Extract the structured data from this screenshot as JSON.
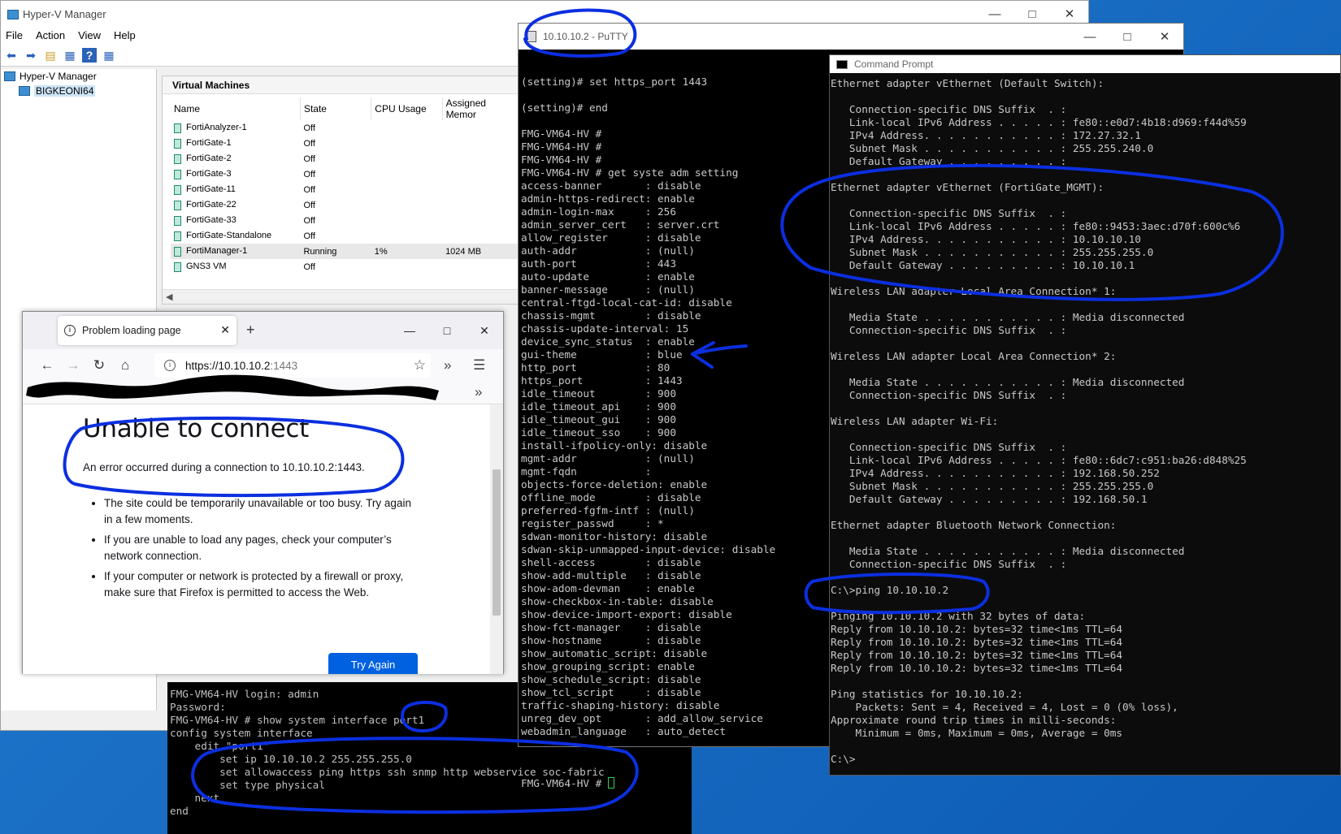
{
  "hyperv": {
    "title": "Hyper-V Manager",
    "menu": [
      "File",
      "Action",
      "View",
      "Help"
    ],
    "tree_root": "Hyper-V Manager",
    "tree_child": "BIGKEONI64",
    "panel_title": "Virtual Machines",
    "columns": [
      "Name",
      "State",
      "CPU Usage",
      "Assigned Memor"
    ],
    "vms": [
      {
        "name": "FortiAnalyzer-1",
        "state": "Off",
        "cpu": "",
        "mem": ""
      },
      {
        "name": "FortiGate-1",
        "state": "Off",
        "cpu": "",
        "mem": ""
      },
      {
        "name": "FortiGate-2",
        "state": "Off",
        "cpu": "",
        "mem": ""
      },
      {
        "name": "FortiGate-3",
        "state": "Off",
        "cpu": "",
        "mem": ""
      },
      {
        "name": "FortiGate-11",
        "state": "Off",
        "cpu": "",
        "mem": ""
      },
      {
        "name": "FortiGate-22",
        "state": "Off",
        "cpu": "",
        "mem": ""
      },
      {
        "name": "FortiGate-33",
        "state": "Off",
        "cpu": "",
        "mem": ""
      },
      {
        "name": "FortiGate-Standalone",
        "state": "Off",
        "cpu": "",
        "mem": ""
      },
      {
        "name": "FortiManager-1",
        "state": "Running",
        "cpu": "1%",
        "mem": "1024 MB"
      },
      {
        "name": "GNS3 VM",
        "state": "Off",
        "cpu": "",
        "mem": ""
      }
    ]
  },
  "putty": {
    "title": "10.10.10.2 - PuTTY",
    "lines": [
      "(setting)# set https_port 1443",
      "",
      "(setting)# end",
      "",
      "FMG-VM64-HV #",
      "FMG-VM64-HV #",
      "FMG-VM64-HV #",
      "FMG-VM64-HV # get syste adm setting",
      "access-banner       : disable",
      "admin-https-redirect: enable",
      "admin-login-max     : 256",
      "admin_server_cert   : server.crt",
      "allow_register      : disable",
      "auth-addr           : (null)",
      "auth-port           : 443",
      "auto-update         : enable",
      "banner-message      : (null)",
      "central-ftgd-local-cat-id: disable",
      "chassis-mgmt        : disable",
      "chassis-update-interval: 15",
      "device_sync_status  : enable",
      "gui-theme           : blue",
      "http_port           : 80",
      "https_port          : 1443",
      "idle_timeout        : 900",
      "idle_timeout_api    : 900",
      "idle_timeout_gui    : 900",
      "idle_timeout_sso    : 900",
      "install-ifpolicy-only: disable",
      "mgmt-addr           : (null)",
      "mgmt-fqdn           :",
      "objects-force-deletion: enable",
      "offline_mode        : disable",
      "preferred-fgfm-intf : (null)",
      "register_passwd     : *",
      "sdwan-monitor-history: disable",
      "sdwan-skip-unmapped-input-device: disable",
      "shell-access        : disable",
      "show-add-multiple   : disable",
      "show-adom-devman    : enable",
      "show-checkbox-in-table: disable",
      "show-device-import-export: disable",
      "show-fct-manager    : disable",
      "show-hostname       : disable",
      "show_automatic_script: disable",
      "show_grouping_script: enable",
      "show_schedule_script: disable",
      "show_tcl_script     : disable",
      "traffic-shaping-history: disable",
      "unreg_dev_opt       : add_allow_service",
      "webadmin_language   : auto_detect",
      ""
    ],
    "prompt": "FMG-VM64-HV # "
  },
  "cmd": {
    "title": "Command Prompt",
    "lines": [
      "Ethernet adapter vEthernet (Default Switch):",
      "",
      "   Connection-specific DNS Suffix  . :",
      "   Link-local IPv6 Address . . . . . : fe80::e0d7:4b18:d969:f44d%59",
      "   IPv4 Address. . . . . . . . . . . : 172.27.32.1",
      "   Subnet Mask . . . . . . . . . . . : 255.255.240.0",
      "   Default Gateway . . . . . . . . . :",
      "",
      "Ethernet adapter vEthernet (FortiGate_MGMT):",
      "",
      "   Connection-specific DNS Suffix  . :",
      "   Link-local IPv6 Address . . . . . : fe80::9453:3aec:d70f:600c%6",
      "   IPv4 Address. . . . . . . . . . . : 10.10.10.10",
      "   Subnet Mask . . . . . . . . . . . : 255.255.255.0",
      "   Default Gateway . . . . . . . . . : 10.10.10.1",
      "",
      "Wireless LAN adapter Local Area Connection* 1:",
      "",
      "   Media State . . . . . . . . . . . : Media disconnected",
      "   Connection-specific DNS Suffix  . :",
      "",
      "Wireless LAN adapter Local Area Connection* 2:",
      "",
      "   Media State . . . . . . . . . . . : Media disconnected",
      "   Connection-specific DNS Suffix  . :",
      "",
      "Wireless LAN adapter Wi-Fi:",
      "",
      "   Connection-specific DNS Suffix  . :",
      "   Link-local IPv6 Address . . . . . : fe80::6dc7:c951:ba26:d848%25",
      "   IPv4 Address. . . . . . . . . . . : 192.168.50.252",
      "   Subnet Mask . . . . . . . . . . . : 255.255.255.0",
      "   Default Gateway . . . . . . . . . : 192.168.50.1",
      "",
      "Ethernet adapter Bluetooth Network Connection:",
      "",
      "   Media State . . . . . . . . . . . : Media disconnected",
      "   Connection-specific DNS Suffix  . :",
      "",
      "C:\\>ping 10.10.10.2",
      "",
      "Pinging 10.10.10.2 with 32 bytes of data:",
      "Reply from 10.10.10.2: bytes=32 time<1ms TTL=64",
      "Reply from 10.10.10.2: bytes=32 time<1ms TTL=64",
      "Reply from 10.10.10.2: bytes=32 time<1ms TTL=64",
      "Reply from 10.10.10.2: bytes=32 time<1ms TTL=64",
      "",
      "Ping statistics for 10.10.10.2:",
      "    Packets: Sent = 4, Received = 4, Lost = 0 (0% loss),",
      "Approximate round trip times in milli-seconds:",
      "    Minimum = 0ms, Maximum = 0ms, Average = 0ms",
      "",
      "C:\\>"
    ]
  },
  "console": {
    "lines": [
      "FMG-VM64-HV login: admin",
      "Password:",
      "FMG-VM64-HV # show system interface port1",
      "config system interface",
      "    edit \"port1\"",
      "        set ip 10.10.10.2 255.255.255.0",
      "        set allowaccess ping https ssh snmp http webservice soc-fabric",
      "        set type physical",
      "    next",
      "end"
    ]
  },
  "firefox": {
    "tab_title": "Problem loading page",
    "url_host": "https://10.10.10.2",
    "url_port": ":1443",
    "error_title": "Unable to connect",
    "error_sub": "An error occurred during a connection to 10.10.10.2:1443.",
    "bullets": [
      "The site could be temporarily unavailable or too busy. Try again in a few moments.",
      "If you are unable to load any pages, check your computer’s network connection.",
      "If your computer or network is protected by a firewall or proxy, make sure that Firefox is permitted to access the Web."
    ],
    "button_label": "Try Again"
  },
  "colors": {
    "annotation": "#0b2fe0",
    "terminal_text": "#c8c8c8",
    "desktop": "#1a6fc4"
  }
}
